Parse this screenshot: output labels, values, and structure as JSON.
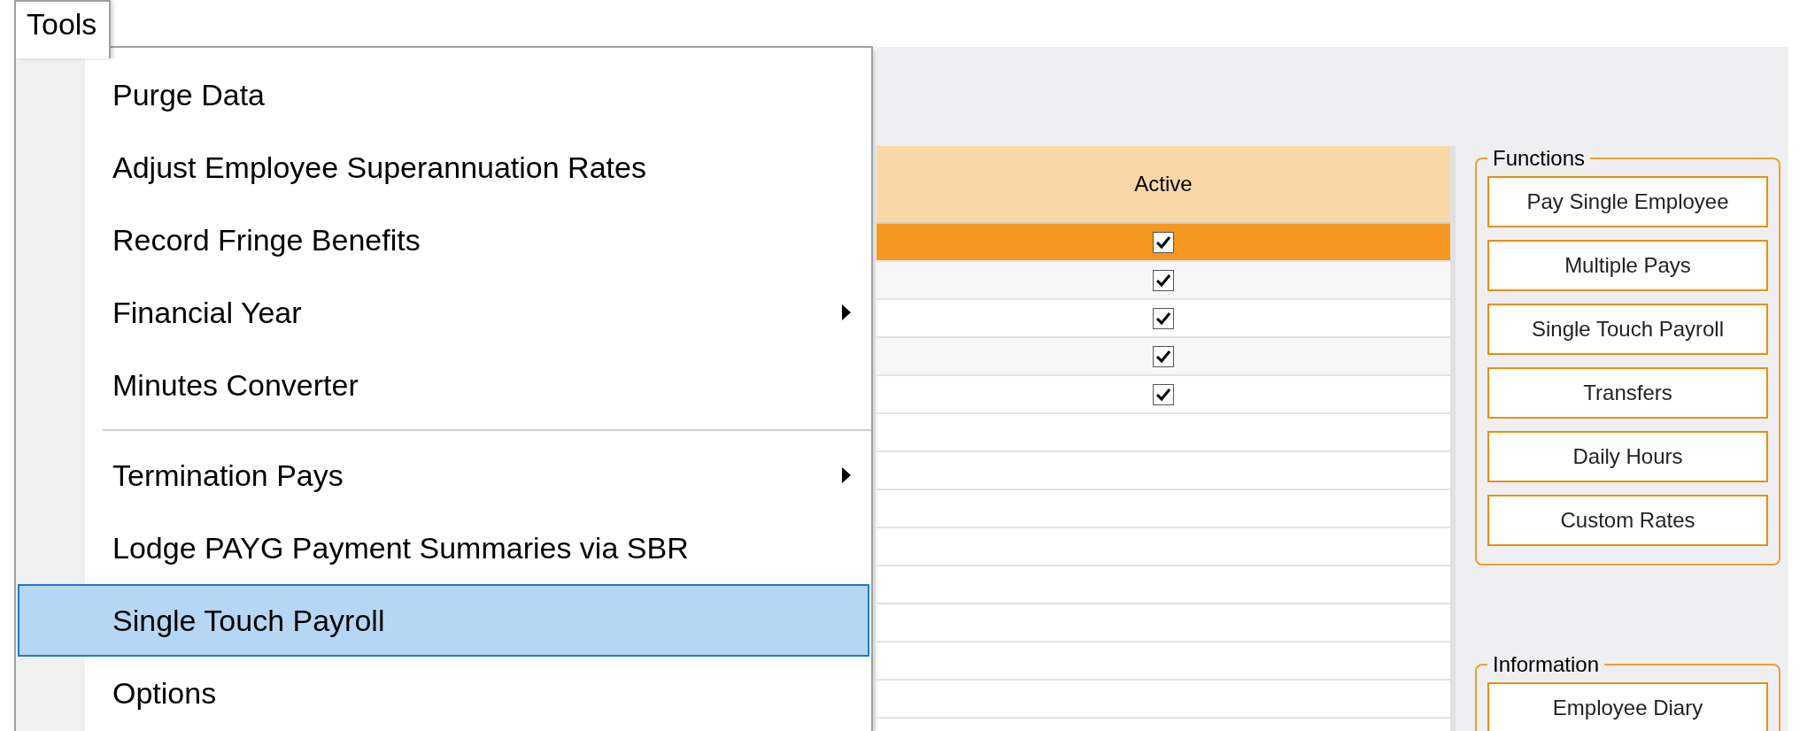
{
  "menu": {
    "title": "Tools",
    "items": [
      {
        "kind": "item",
        "label": "Purge Data",
        "submenu": false,
        "selected": false
      },
      {
        "kind": "item",
        "label": "Adjust Employee Superannuation Rates",
        "submenu": false,
        "selected": false
      },
      {
        "kind": "item",
        "label": "Record Fringe Benefits",
        "submenu": false,
        "selected": false
      },
      {
        "kind": "item",
        "label": "Financial Year",
        "submenu": true,
        "selected": false
      },
      {
        "kind": "item",
        "label": "Minutes Converter",
        "submenu": false,
        "selected": false
      },
      {
        "kind": "separator"
      },
      {
        "kind": "item",
        "label": "Termination Pays",
        "submenu": true,
        "selected": false
      },
      {
        "kind": "item",
        "label": "Lodge PAYG Payment Summaries via SBR",
        "submenu": false,
        "selected": false
      },
      {
        "kind": "item",
        "label": "Single Touch Payroll",
        "submenu": false,
        "selected": true
      },
      {
        "kind": "item",
        "label": "Options",
        "submenu": false,
        "selected": false
      }
    ]
  },
  "grid": {
    "columns": [
      "Active"
    ],
    "rows": [
      {
        "kind": "record",
        "active": true,
        "selected": true
      },
      {
        "kind": "record",
        "active": true,
        "selected": false
      },
      {
        "kind": "record",
        "active": true,
        "selected": false
      },
      {
        "kind": "record",
        "active": true,
        "selected": false
      },
      {
        "kind": "record",
        "active": true,
        "selected": false
      },
      {
        "kind": "blank"
      },
      {
        "kind": "blank"
      },
      {
        "kind": "blank"
      },
      {
        "kind": "blank"
      },
      {
        "kind": "blank"
      },
      {
        "kind": "blank"
      },
      {
        "kind": "blank"
      },
      {
        "kind": "blank"
      },
      {
        "kind": "blank"
      }
    ]
  },
  "functions": {
    "title": "Functions",
    "buttons": [
      "Pay Single Employee",
      "Multiple Pays",
      "Single Touch Payroll",
      "Transfers",
      "Daily Hours",
      "Custom Rates"
    ]
  },
  "information": {
    "title": "Information",
    "buttons": [
      "Employee Diary"
    ]
  }
}
